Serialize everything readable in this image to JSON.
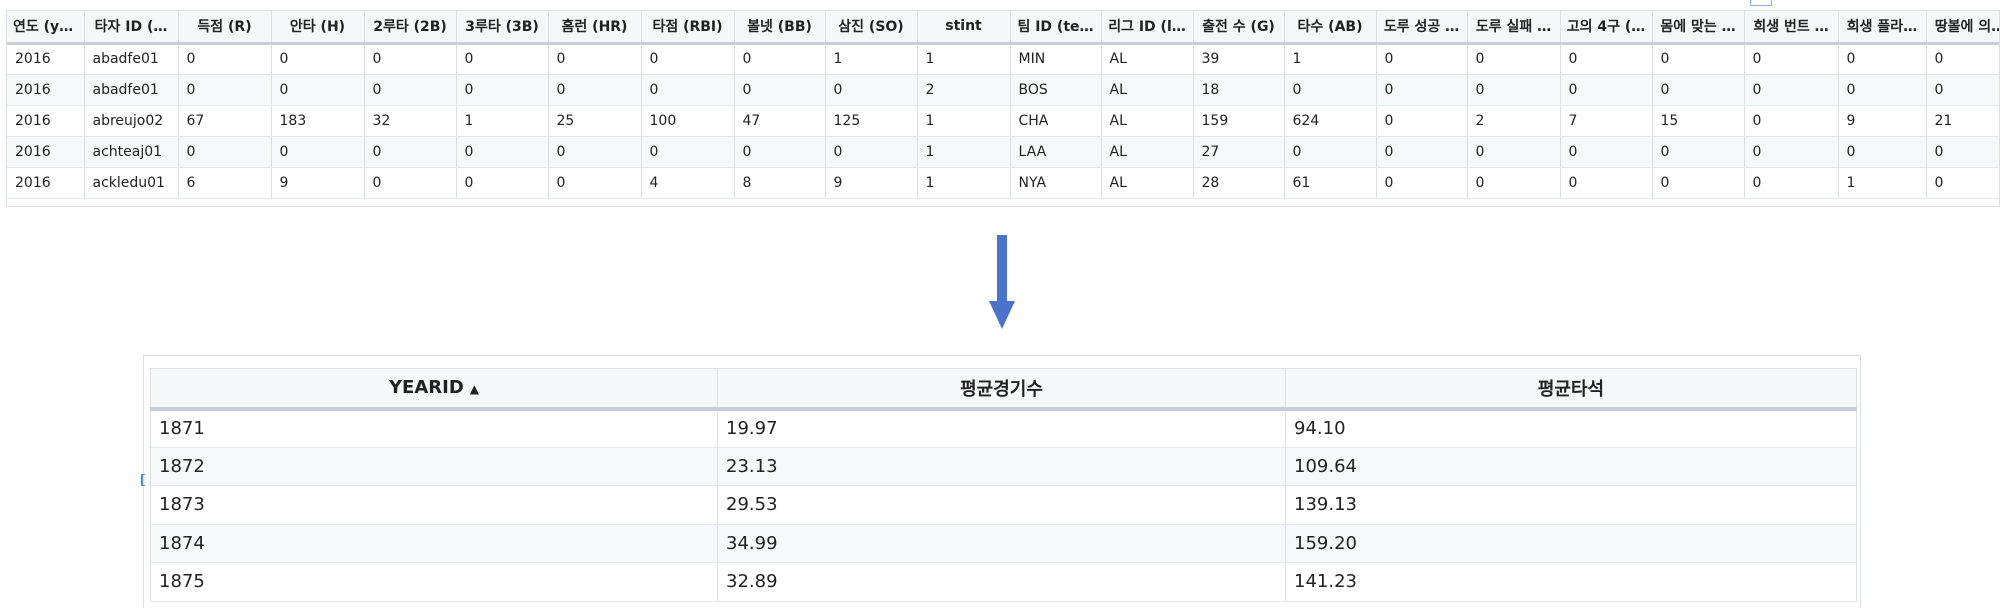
{
  "source_table": {
    "columns": [
      "연도 (y…",
      "타자 ID (…",
      "득점 (R)",
      "안타 (H)",
      "2루타 (2B)",
      "3루타 (3B)",
      "홈런 (HR)",
      "타점 (RBI)",
      "볼넷 (BB)",
      "삼진 (SO)",
      "stint",
      "팀 ID (te…",
      "리그 ID (l…",
      "출전 수 (G)",
      "타수 (AB)",
      "도루 성공 …",
      "도루 실패 …",
      "고의 4구 (…",
      "몸에 맞는 …",
      "희생 번트 …",
      "희생 플라…",
      "땅볼에 의…"
    ],
    "rows": [
      [
        "2016",
        "abadfe01",
        "0",
        "0",
        "0",
        "0",
        "0",
        "0",
        "0",
        "1",
        "1",
        "MIN",
        "AL",
        "39",
        "1",
        "0",
        "0",
        "0",
        "0",
        "0",
        "0",
        "0"
      ],
      [
        "2016",
        "abadfe01",
        "0",
        "0",
        "0",
        "0",
        "0",
        "0",
        "0",
        "0",
        "2",
        "BOS",
        "AL",
        "18",
        "0",
        "0",
        "0",
        "0",
        "0",
        "0",
        "0",
        "0"
      ],
      [
        "2016",
        "abreujo02",
        "67",
        "183",
        "32",
        "1",
        "25",
        "100",
        "47",
        "125",
        "1",
        "CHA",
        "AL",
        "159",
        "624",
        "0",
        "2",
        "7",
        "15",
        "0",
        "9",
        "21"
      ],
      [
        "2016",
        "achteaj01",
        "0",
        "0",
        "0",
        "0",
        "0",
        "0",
        "0",
        "0",
        "1",
        "LAA",
        "AL",
        "27",
        "0",
        "0",
        "0",
        "0",
        "0",
        "0",
        "0",
        "0"
      ],
      [
        "2016",
        "ackledu01",
        "6",
        "9",
        "0",
        "0",
        "0",
        "4",
        "8",
        "9",
        "1",
        "NYA",
        "AL",
        "28",
        "61",
        "0",
        "0",
        "0",
        "0",
        "0",
        "1",
        "0"
      ]
    ]
  },
  "result_table": {
    "columns": [
      "YEARID",
      "평균경기수",
      "평균타석"
    ],
    "sort_indicator": "▲",
    "rows": [
      [
        "1871",
        "19.97",
        "94.10"
      ],
      [
        "1872",
        "23.13",
        "109.64"
      ],
      [
        "1873",
        "29.53",
        "139.13"
      ],
      [
        "1874",
        "34.99",
        "159.20"
      ],
      [
        "1875",
        "32.89",
        "141.23"
      ]
    ]
  },
  "colors": {
    "arrow": "#4a74c9",
    "header_bg": "#f6f7f9",
    "border": "#dcdfe3",
    "row_alt": "#f7f8fa"
  }
}
